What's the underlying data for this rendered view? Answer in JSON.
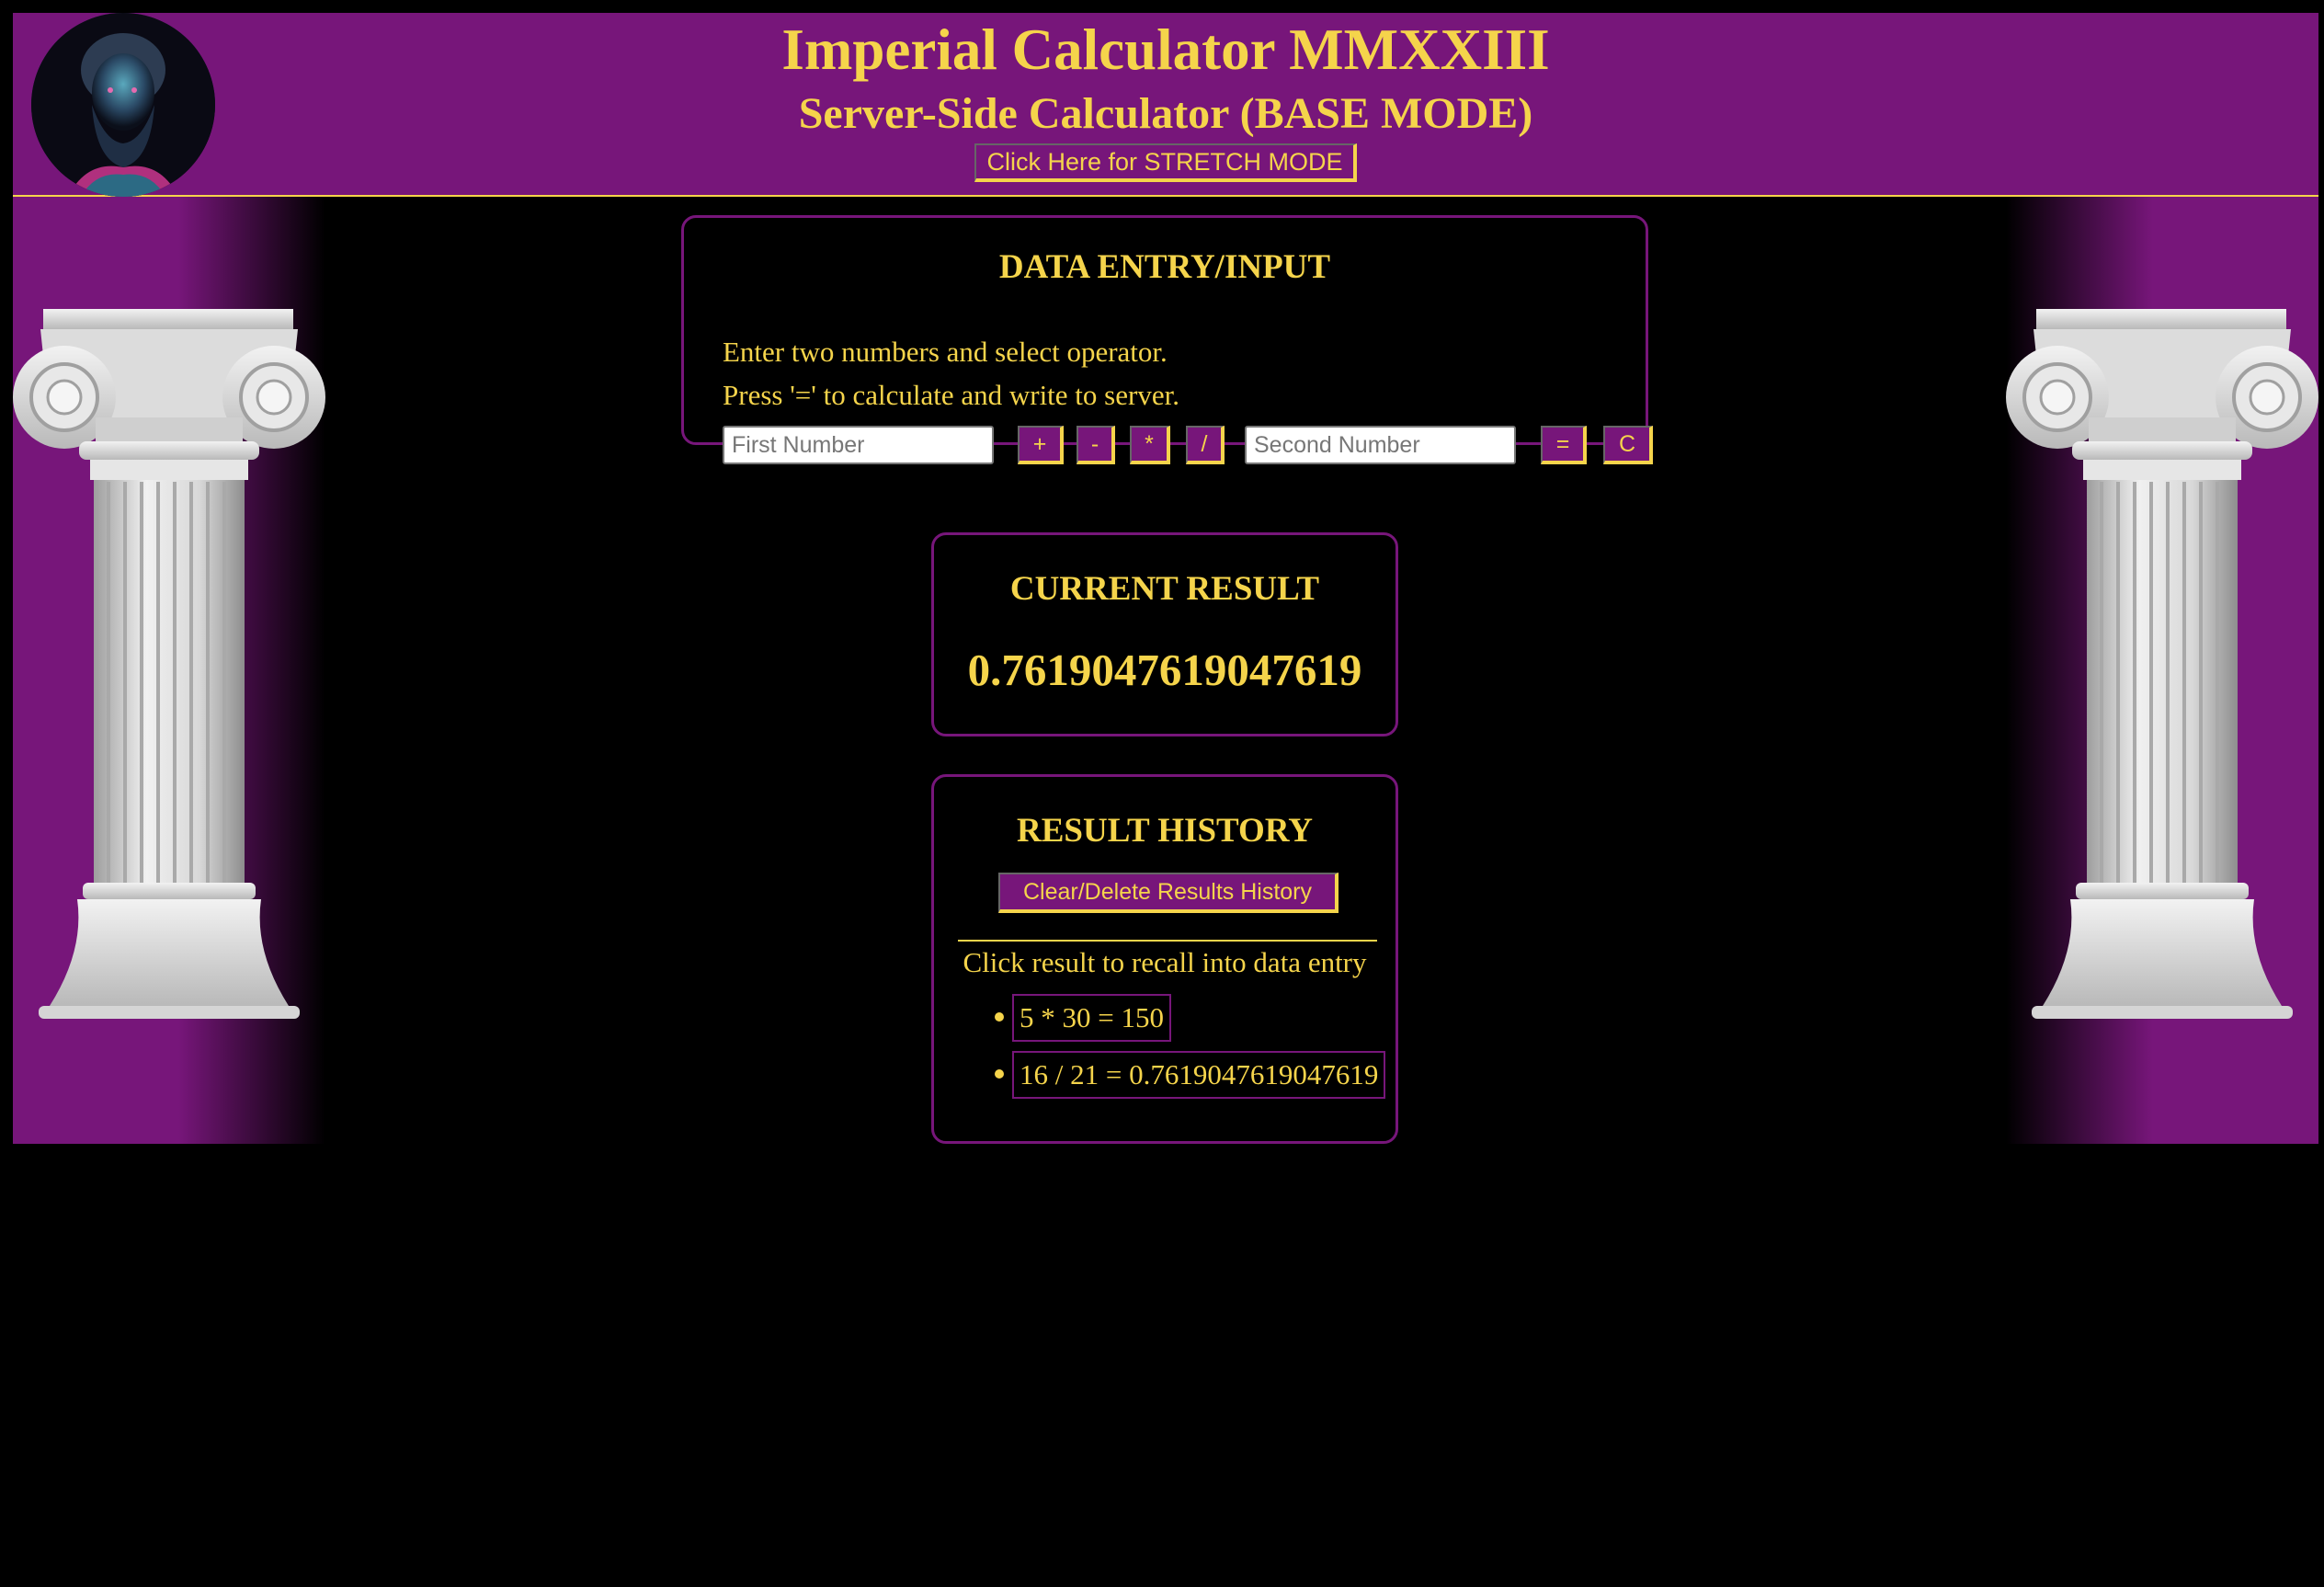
{
  "header": {
    "title": "Imperial Calculator MMXXIII",
    "subtitle": "Server-Side Calculator (BASE MODE)",
    "stretch_button": "Click Here for STRETCH MODE",
    "bust_icon": "emperor-bust-image"
  },
  "entry": {
    "title": "DATA ENTRY/INPUT",
    "instruction_line1": "Enter two numbers and select operator.",
    "instruction_line2": "Press '=' to calculate and write to server.",
    "first_placeholder": "First Number",
    "second_placeholder": "Second Number",
    "first_value": "",
    "second_value": "",
    "operators": {
      "plus": "+",
      "minus": "-",
      "multiply": "*",
      "divide": "/",
      "equals": "=",
      "clear": "C"
    }
  },
  "result": {
    "title": "CURRENT RESULT",
    "value": "0.7619047619047619"
  },
  "history": {
    "title": "RESULT HISTORY",
    "clear_button": "Clear/Delete Results History",
    "hint": "Click result to recall into data entry",
    "items": [
      "5 * 30 = 150",
      "16 / 21 = 0.7619047619047619"
    ]
  },
  "colors": {
    "accent_purple": "#77167a",
    "accent_gold": "#f5d44b",
    "background": "#000000"
  }
}
